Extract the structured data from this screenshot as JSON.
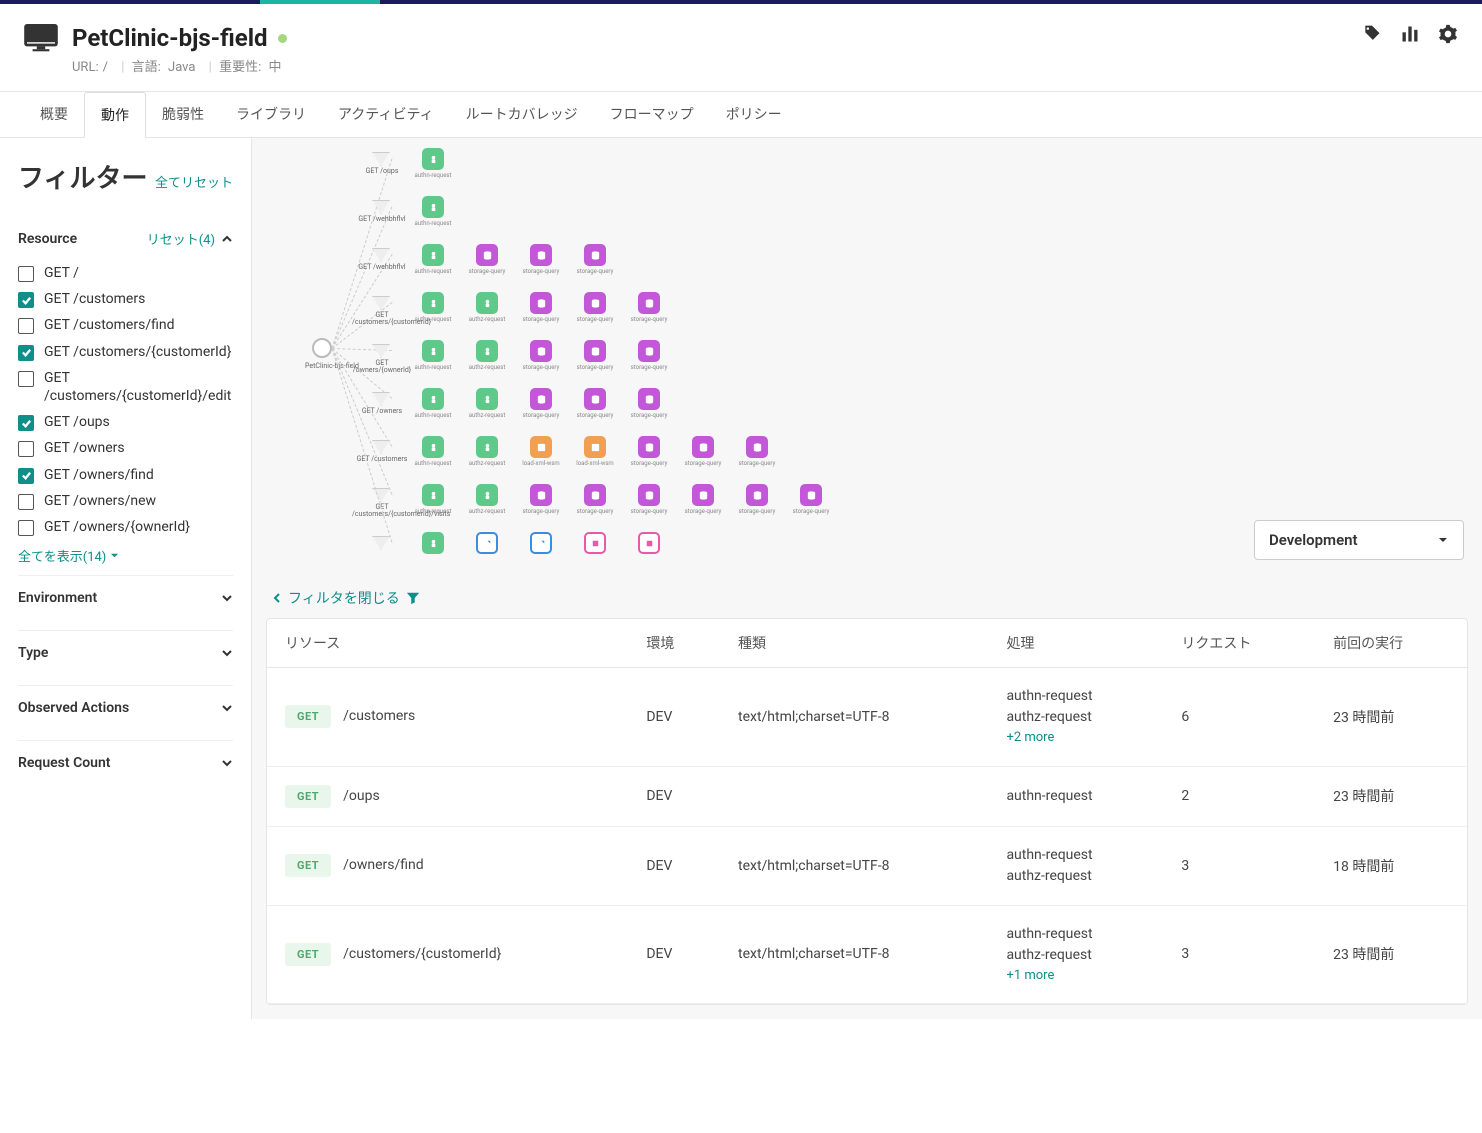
{
  "header": {
    "app_name": "PetClinic-bjs-field",
    "meta": {
      "url_label": "URL:",
      "url_value": "/",
      "lang_label": "言語:",
      "lang_value": "Java",
      "importance_label": "重要性:",
      "importance_value": "中"
    }
  },
  "tabs": [
    "概要",
    "動作",
    "脆弱性",
    "ライブラリ",
    "アクティビティ",
    "ルートカバレッジ",
    "フローマップ",
    "ポリシー"
  ],
  "active_tab": 1,
  "sidebar": {
    "title": "フィルター",
    "reset_all": "全てリセット",
    "resource": {
      "title": "Resource",
      "reset": "リセット(4)",
      "items": [
        {
          "label": "GET /",
          "checked": false
        },
        {
          "label": "GET /customers",
          "checked": true
        },
        {
          "label": "GET /customers/find",
          "checked": false
        },
        {
          "label": "GET /customers/{customerId}",
          "checked": true
        },
        {
          "label": "GET /customers/{customerId}/edit",
          "checked": false
        },
        {
          "label": "GET /oups",
          "checked": true
        },
        {
          "label": "GET /owners",
          "checked": false
        },
        {
          "label": "GET /owners/find",
          "checked": true
        },
        {
          "label": "GET /owners/new",
          "checked": false
        },
        {
          "label": "GET /owners/{ownerId}",
          "checked": false
        }
      ],
      "show_all": "全てを表示(14)"
    },
    "collapsed": [
      "Environment",
      "Type",
      "Observed Actions",
      "Request Count"
    ]
  },
  "flowgraph": {
    "origin": "PetClinic-bjs-field",
    "rows": [
      {
        "method": "GET /oups",
        "nodes": [
          {
            "t": "green",
            "l": "authn-request"
          }
        ]
      },
      {
        "method": "GET /wehbhflvl",
        "nodes": [
          {
            "t": "green",
            "l": "authn-request"
          }
        ]
      },
      {
        "method": "GET /wehbhflvl",
        "nodes": [
          {
            "t": "green",
            "l": "authn-request"
          },
          {
            "t": "purple",
            "l": "storage-query"
          },
          {
            "t": "purple",
            "l": "storage-query"
          },
          {
            "t": "purple",
            "l": "storage-query"
          }
        ]
      },
      {
        "method": "GET /customers/{customerId}",
        "nodes": [
          {
            "t": "green",
            "l": "authn-request"
          },
          {
            "t": "green",
            "l": "authz-request"
          },
          {
            "t": "purple",
            "l": "storage-query"
          },
          {
            "t": "purple",
            "l": "storage-query"
          },
          {
            "t": "purple",
            "l": "storage-query"
          }
        ]
      },
      {
        "method": "GET /owners/{ownerId}",
        "nodes": [
          {
            "t": "green",
            "l": "authn-request"
          },
          {
            "t": "green",
            "l": "authz-request"
          },
          {
            "t": "purple",
            "l": "storage-query"
          },
          {
            "t": "purple",
            "l": "storage-query"
          },
          {
            "t": "purple",
            "l": "storage-query"
          }
        ]
      },
      {
        "method": "GET /owners",
        "nodes": [
          {
            "t": "green",
            "l": "authn-request"
          },
          {
            "t": "green",
            "l": "authz-request"
          },
          {
            "t": "purple",
            "l": "storage-query"
          },
          {
            "t": "purple",
            "l": "storage-query"
          },
          {
            "t": "purple",
            "l": "storage-query"
          }
        ]
      },
      {
        "method": "GET /customers",
        "nodes": [
          {
            "t": "green",
            "l": "authn-request"
          },
          {
            "t": "green",
            "l": "authz-request"
          },
          {
            "t": "orange",
            "l": "load-xml-wsm"
          },
          {
            "t": "orange",
            "l": "load-xml-wsm"
          },
          {
            "t": "purple",
            "l": "storage-query"
          },
          {
            "t": "purple",
            "l": "storage-query"
          },
          {
            "t": "purple",
            "l": "storage-query"
          }
        ]
      },
      {
        "method": "GET /customers/{customerId}/visits",
        "nodes": [
          {
            "t": "green",
            "l": "authn-request"
          },
          {
            "t": "green",
            "l": "authz-request"
          },
          {
            "t": "purple",
            "l": "storage-query"
          },
          {
            "t": "purple",
            "l": "storage-query"
          },
          {
            "t": "purple",
            "l": "storage-query"
          },
          {
            "t": "purple",
            "l": "storage-query"
          },
          {
            "t": "purple",
            "l": "storage-query"
          },
          {
            "t": "purple",
            "l": "storage-query"
          }
        ]
      },
      {
        "method": "",
        "nodes": [
          {
            "t": "green",
            "l": ""
          },
          {
            "t": "bluebox",
            "l": ""
          },
          {
            "t": "bluebox",
            "l": ""
          },
          {
            "t": "pinkbox",
            "l": ""
          },
          {
            "t": "pinkbox",
            "l": ""
          }
        ]
      }
    ]
  },
  "env_dropdown": "Development",
  "close_filter": "フィルタを閉じる",
  "table": {
    "headers": [
      "リソース",
      "環境",
      "種類",
      "処理",
      "リクエスト",
      "前回の実行"
    ],
    "rows": [
      {
        "method": "GET",
        "path": "/customers",
        "env": "DEV",
        "type": "text/html;charset=UTF-8",
        "actions": [
          "authn-request",
          "authz-request"
        ],
        "more": "+2 more",
        "requests": "6",
        "last": "23 時間前"
      },
      {
        "method": "GET",
        "path": "/oups",
        "env": "DEV",
        "type": "",
        "actions": [
          "authn-request"
        ],
        "more": "",
        "requests": "2",
        "last": "23 時間前"
      },
      {
        "method": "GET",
        "path": "/owners/find",
        "env": "DEV",
        "type": "text/html;charset=UTF-8",
        "actions": [
          "authn-request",
          "authz-request"
        ],
        "more": "",
        "requests": "3",
        "last": "18 時間前"
      },
      {
        "method": "GET",
        "path": "/customers/{customerId}",
        "env": "DEV",
        "type": "text/html;charset=UTF-8",
        "actions": [
          "authn-request",
          "authz-request"
        ],
        "more": "+1 more",
        "requests": "3",
        "last": "23 時間前"
      }
    ]
  }
}
